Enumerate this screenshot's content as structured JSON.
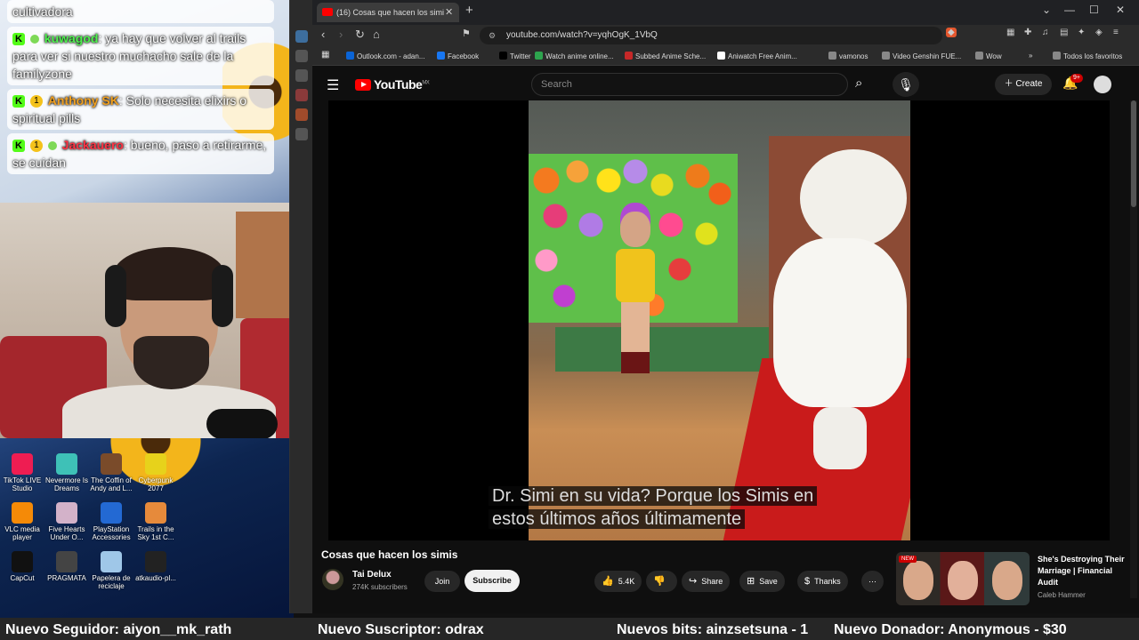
{
  "stream_chat": {
    "messages": [
      {
        "user": "",
        "text": "cultivadora"
      },
      {
        "user": "kuwagod",
        "text": ": ya hay que volver al trails para ver si nuestro muchacho sale de la familyzone"
      },
      {
        "user": "Anthony SK",
        "text": ": Solo necesita elixirs o spiritual pills"
      },
      {
        "user": "Jackauero",
        "text": ": bueno, paso a retirarme, se cuidan"
      }
    ]
  },
  "desktop_icons": [
    {
      "label": "TikTok LIVE Studio",
      "color": "#ee1d52"
    },
    {
      "label": "Nevermore Is Dreams",
      "color": "#3ec1b7"
    },
    {
      "label": "The Coffin of Andy and L...",
      "color": "#7a4b2a"
    },
    {
      "label": "Cyberpunk 2077",
      "color": "#e7d21b"
    },
    {
      "label": "VLC media player",
      "color": "#f58a07"
    },
    {
      "label": "Five Hearts Under O...",
      "color": "#d3b2c9"
    },
    {
      "label": "PlayStation Accessories",
      "color": "#2369d3"
    },
    {
      "label": "Trails in the Sky 1st C...",
      "color": "#e68a3b"
    },
    {
      "label": "CapCut",
      "color": "#111111"
    },
    {
      "label": "PRAGMATA",
      "color": "#444444"
    },
    {
      "label": "Papelera de reciclaje",
      "color": "#9fc7e8"
    },
    {
      "label": "atkaudio-pl...",
      "color": "#222222"
    }
  ],
  "browser": {
    "tab_title": "(16) Cosas que hacen los simi",
    "url": "youtube.com/watch?v=yqhOgK_1VbQ",
    "bookmarks": [
      {
        "label": "Outlook.com - adan...",
        "color": "#0a64d6"
      },
      {
        "label": "Facebook",
        "color": "#1877f2"
      },
      {
        "label": "Twitter",
        "color": "#000000"
      },
      {
        "label": "Watch anime online...",
        "color": "#2da44e"
      },
      {
        "label": "Subbed Anime Sche...",
        "color": "#c62828"
      },
      {
        "label": "Aniwatch Free Anim...",
        "color": "#ffffff"
      },
      {
        "label": "vamonos",
        "color": "#888888"
      },
      {
        "label": "Video Genshin FUE...",
        "color": "#888888"
      },
      {
        "label": "Wow",
        "color": "#888888"
      }
    ],
    "all_bookmarks": "Todos los favoritos"
  },
  "youtube": {
    "region": "MX",
    "search_placeholder": "Search",
    "create_label": "Create",
    "notifications": "9+",
    "captions_line1": "Dr. Simi en su vida? Porque los Simis en",
    "captions_line2": "estos últimos años últimamente",
    "video_title": "Cosas que hacen los simis",
    "channel_name": "Tai Delux",
    "channel_subs": "274K subscribers",
    "join_label": "Join",
    "subscribe_label": "Subscribe",
    "likes": "5.4K",
    "share_label": "Share",
    "save_label": "Save",
    "thanks_label": "Thanks",
    "recommendation": {
      "title": "She's Destroying Their Marriage | Financial Audit",
      "channel": "Caleb Hammer",
      "badge": "NEW"
    }
  },
  "ticker": {
    "follower": "Nuevo Seguidor: aiyon__mk_rath",
    "subscriber": "Nuevo Suscriptor: odrax",
    "bits": "Nuevos bits: ainzsetsuna - 1",
    "donor": "Nuevo Donador: Anonymous - $30"
  }
}
